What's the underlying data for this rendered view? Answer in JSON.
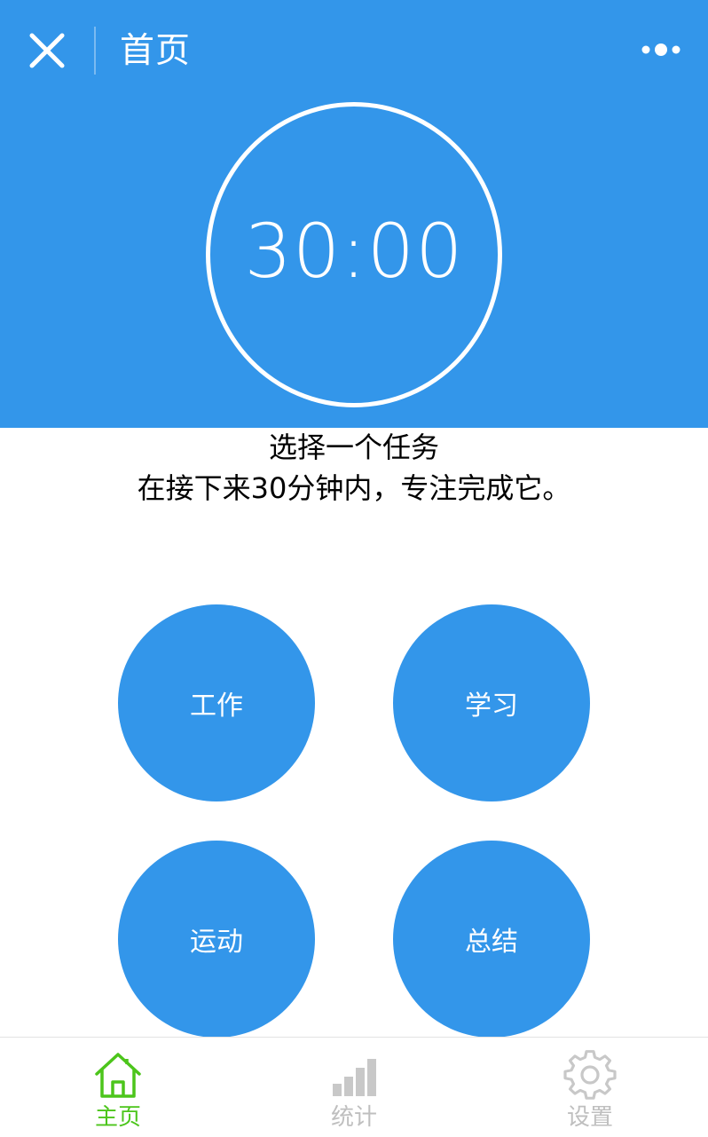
{
  "colors": {
    "primary": "#3396EA",
    "active_tab": "#4CC51B",
    "inactive_tab": "#BFBFBF",
    "text": "#000000",
    "on_primary": "#ffffff"
  },
  "header": {
    "title": "首页",
    "close_icon": "close-icon",
    "more_icon": "more-dots-icon"
  },
  "timer": {
    "display": "30:00"
  },
  "instructions": {
    "line1": "选择一个任务",
    "line2": "在接下来30分钟内，专注完成它。"
  },
  "tasks": [
    {
      "label": "工作"
    },
    {
      "label": "学习"
    },
    {
      "label": "运动"
    },
    {
      "label": "总结"
    }
  ],
  "tabbar": {
    "items": [
      {
        "label": "主页",
        "icon": "home-icon",
        "active": true
      },
      {
        "label": "统计",
        "icon": "bar-chart-icon",
        "active": false
      },
      {
        "label": "设置",
        "icon": "gear-icon",
        "active": false
      }
    ]
  }
}
